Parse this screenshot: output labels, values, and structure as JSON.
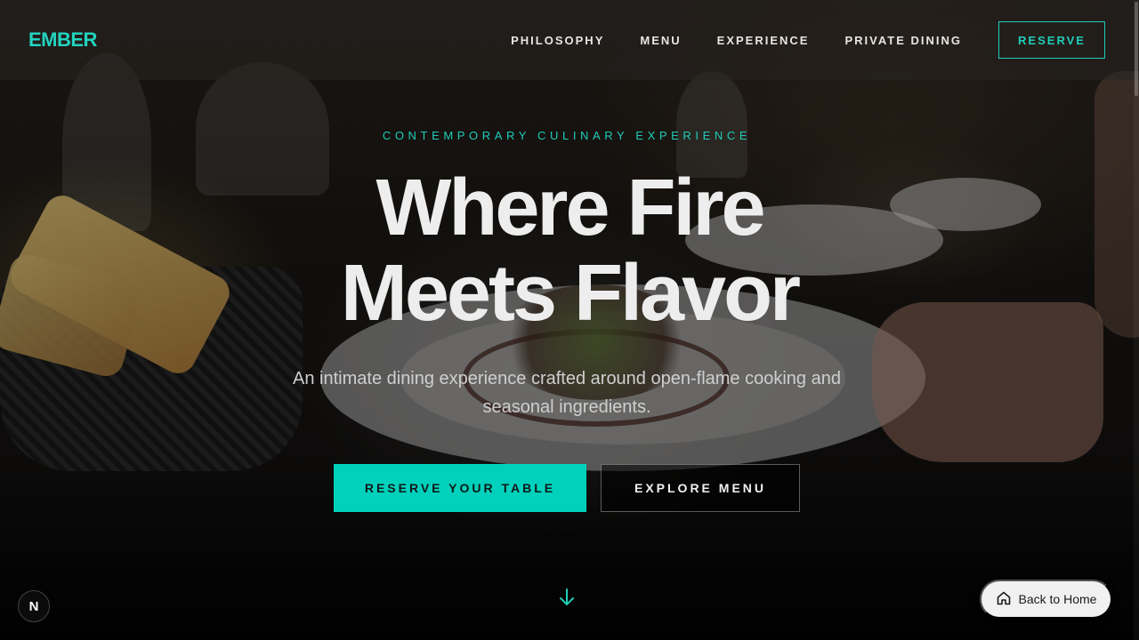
{
  "brand": {
    "logo_text": "EMBER",
    "accent_color": "#1fcdb8",
    "primary_cta_color": "#00d1bc"
  },
  "nav": {
    "items": [
      {
        "label": "PHILOSOPHY"
      },
      {
        "label": "MENU"
      },
      {
        "label": "EXPERIENCE"
      },
      {
        "label": "PRIVATE DINING"
      }
    ],
    "reserve_label": "RESERVE"
  },
  "hero": {
    "eyebrow": "CONTEMPORARY CULINARY EXPERIENCE",
    "headline_line1": "Where Fire",
    "headline_line2": "Meets Flavor",
    "subtext": "An intimate dining experience crafted around open-flame cooking and seasonal ingredients.",
    "primary_cta": "RESERVE YOUR TABLE",
    "secondary_cta": "EXPLORE MENU",
    "scroll_icon": "arrow-down-icon"
  },
  "widgets": {
    "dev_badge_letter": "N",
    "back_home_label": "Back to Home",
    "back_home_icon": "home-icon"
  }
}
